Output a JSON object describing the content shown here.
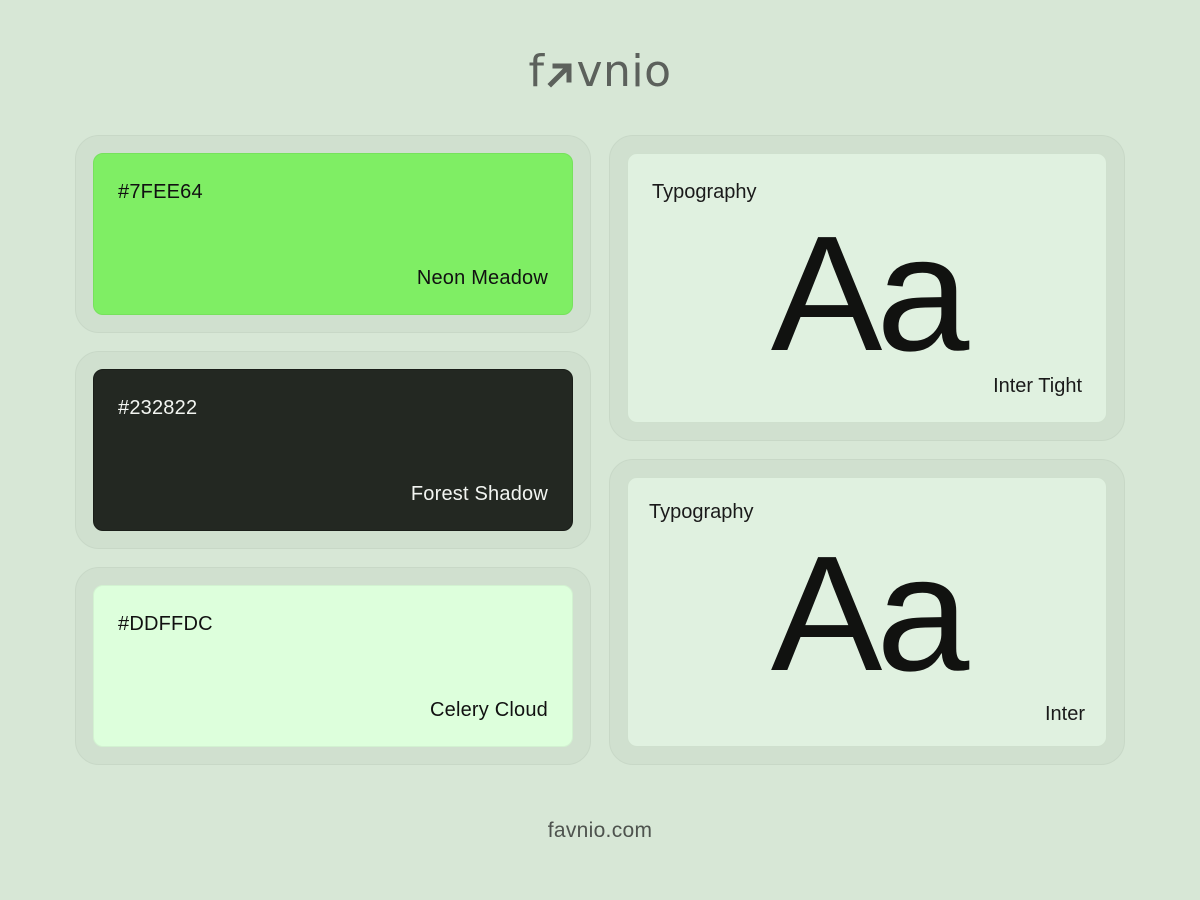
{
  "brand": {
    "logo_text_start": "f",
    "logo_text_end": "vnio",
    "logo_mark_icon": "arrow-up-right-icon",
    "logo_color": "#5c615c"
  },
  "palette": [
    {
      "hex": "#7FEE64",
      "name": "Neon Meadow",
      "color": "#7fee64",
      "text_color": "#111111"
    },
    {
      "hex": "#232822",
      "name": "Forest Shadow",
      "color": "#232822",
      "text_color": "#f2f5f1"
    },
    {
      "hex": "#DDFFDC",
      "name": "Celery Cloud",
      "color": "#ddffdc",
      "text_color": "#111111"
    }
  ],
  "typography": [
    {
      "label": "Typography",
      "sample": "Aa",
      "font_name": "Inter Tight"
    },
    {
      "label": "Typography",
      "sample": "Aa",
      "font_name": "Inter"
    }
  ],
  "footer": {
    "url": "favnio.com"
  },
  "colors": {
    "background": "#d7e7d6",
    "card_outer": "#d0e0cf",
    "card_inner": "#e0f1e0"
  }
}
